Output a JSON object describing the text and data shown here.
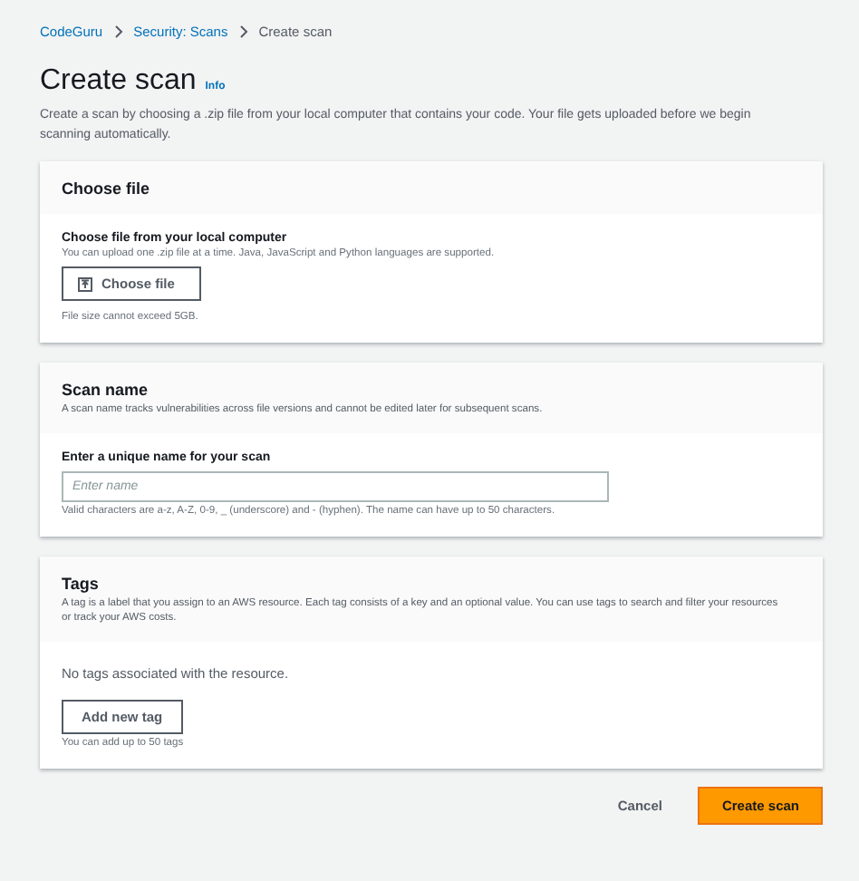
{
  "breadcrumbs": [
    {
      "label": "CodeGuru",
      "current": false
    },
    {
      "label": "Security: Scans",
      "current": false
    },
    {
      "label": "Create scan",
      "current": true
    }
  ],
  "title": "Create scan",
  "info_link": "Info",
  "description": "Create a scan by choosing a .zip file from your local computer that contains your code. Your file gets uploaded before we begin scanning automatically.",
  "choose_file": {
    "heading": "Choose file",
    "label": "Choose file from your local computer",
    "hint": "You can upload one .zip file at a time. Java, JavaScript and Python languages are supported.",
    "button": "Choose file",
    "constraint": "File size cannot exceed 5GB."
  },
  "scan_name": {
    "heading": "Scan name",
    "description": "A scan name tracks vulnerabilities across file versions and cannot be edited later for subsequent scans.",
    "label": "Enter a unique name for your scan",
    "placeholder": "Enter name",
    "constraint": "Valid characters are a-z, A-Z, 0-9, _ (underscore) and - (hyphen). The name can have up to 50 characters."
  },
  "tags": {
    "heading": "Tags",
    "description": "A tag is a label that you assign to an AWS resource. Each tag consists of a key and an optional value. You can use tags to search and filter your resources or track your AWS costs.",
    "empty": "No tags associated with the resource.",
    "button": "Add new tag",
    "constraint": "You can add up to 50 tags"
  },
  "actions": [
    {
      "label": "Cancel",
      "kind": "link"
    },
    {
      "label": "Create scan",
      "kind": "primary"
    }
  ]
}
